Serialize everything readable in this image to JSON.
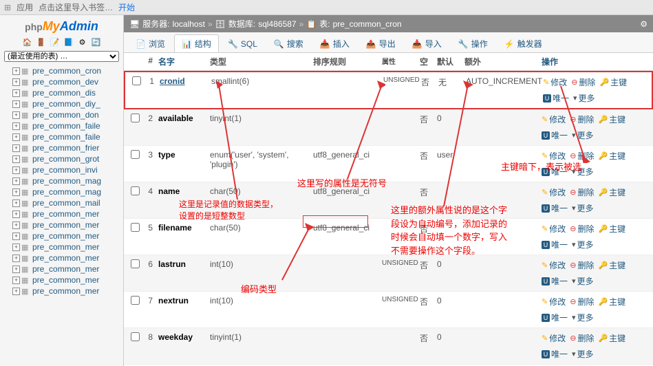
{
  "topbar": {
    "apps": "应用",
    "bookmark": "点击这里导入书签…",
    "start": "开始"
  },
  "logo": {
    "php": "php",
    "my": "My",
    "admin": "Admin"
  },
  "recent": {
    "placeholder": "(最近使用的表) …"
  },
  "tree": [
    "pre_common_cron",
    "pre_common_dev",
    "pre_common_dis",
    "pre_common_diy_",
    "pre_common_don",
    "pre_common_faile",
    "pre_common_faile",
    "pre_common_frier",
    "pre_common_grot",
    "pre_common_invi",
    "pre_common_mag",
    "pre_common_mag",
    "pre_common_mail",
    "pre_common_mer",
    "pre_common_mer",
    "pre_common_mer",
    "pre_common_mer",
    "pre_common_mer",
    "pre_common_mer",
    "pre_common_mer",
    "pre_common_mer"
  ],
  "breadcrumb": {
    "server_lbl": "服务器:",
    "server": "localhost",
    "db_lbl": "数据库:",
    "db": "sql486587",
    "tbl_lbl": "表:",
    "tbl": "pre_common_cron"
  },
  "tabs": [
    {
      "icon": "📄",
      "label": "浏览"
    },
    {
      "icon": "📊",
      "label": "结构",
      "active": true
    },
    {
      "icon": "🔧",
      "label": "SQL"
    },
    {
      "icon": "🔍",
      "label": "搜索"
    },
    {
      "icon": "📥",
      "label": "插入"
    },
    {
      "icon": "📤",
      "label": "导出"
    },
    {
      "icon": "📥",
      "label": "导入"
    },
    {
      "icon": "🔧",
      "label": "操作"
    },
    {
      "icon": "⚡",
      "label": "触发器"
    }
  ],
  "headers": {
    "num": "#",
    "name": "名字",
    "type": "类型",
    "coll": "排序规则",
    "attr": "属性",
    "null": "空",
    "def": "默认",
    "extra": "额外",
    "ops": "操作"
  },
  "ops": {
    "edit": "修改",
    "del": "删除",
    "pk": "主键",
    "uni": "唯一",
    "more": "更多"
  },
  "columns": [
    {
      "n": 1,
      "name": "cronid",
      "type": "smallint(6)",
      "coll": "",
      "attr": "UNSIGNED",
      "null": "否",
      "def": "无",
      "extra": "AUTO_INCREMENT",
      "pk": true
    },
    {
      "n": 2,
      "name": "available",
      "type": "tinyint(1)",
      "coll": "",
      "attr": "",
      "null": "否",
      "def": "0",
      "extra": ""
    },
    {
      "n": 3,
      "name": "type",
      "type": "enum('user', 'system', 'plugin')",
      "coll": "utf8_general_ci",
      "attr": "",
      "null": "否",
      "def": "user",
      "extra": ""
    },
    {
      "n": 4,
      "name": "name",
      "type": "char(50)",
      "coll": "utf8_general_ci",
      "attr": "",
      "null": "否",
      "def": "",
      "extra": ""
    },
    {
      "n": 5,
      "name": "filename",
      "type": "char(50)",
      "coll": "utf8_general_ci",
      "attr": "",
      "null": "否",
      "def": "",
      "extra": ""
    },
    {
      "n": 6,
      "name": "lastrun",
      "type": "int(10)",
      "coll": "",
      "attr": "UNSIGNED",
      "null": "否",
      "def": "0",
      "extra": ""
    },
    {
      "n": 7,
      "name": "nextrun",
      "type": "int(10)",
      "coll": "",
      "attr": "UNSIGNED",
      "null": "否",
      "def": "0",
      "extra": ""
    },
    {
      "n": 8,
      "name": "weekday",
      "type": "tinyint(1)",
      "coll": "",
      "attr": "",
      "null": "否",
      "def": "0",
      "extra": ""
    }
  ],
  "annotations": {
    "a1": "这里是记录值的数据类型，",
    "a1b": "设置的是短整数型",
    "a2": "这里写的属性是无符号",
    "a3": "这里的额外属性说的是这个字段设为自动编号，添加记录的时候会自动填一个数字，写入不需要操作这个字段。",
    "a4": "编码类型",
    "a5": "主键暗下，表示被选"
  }
}
